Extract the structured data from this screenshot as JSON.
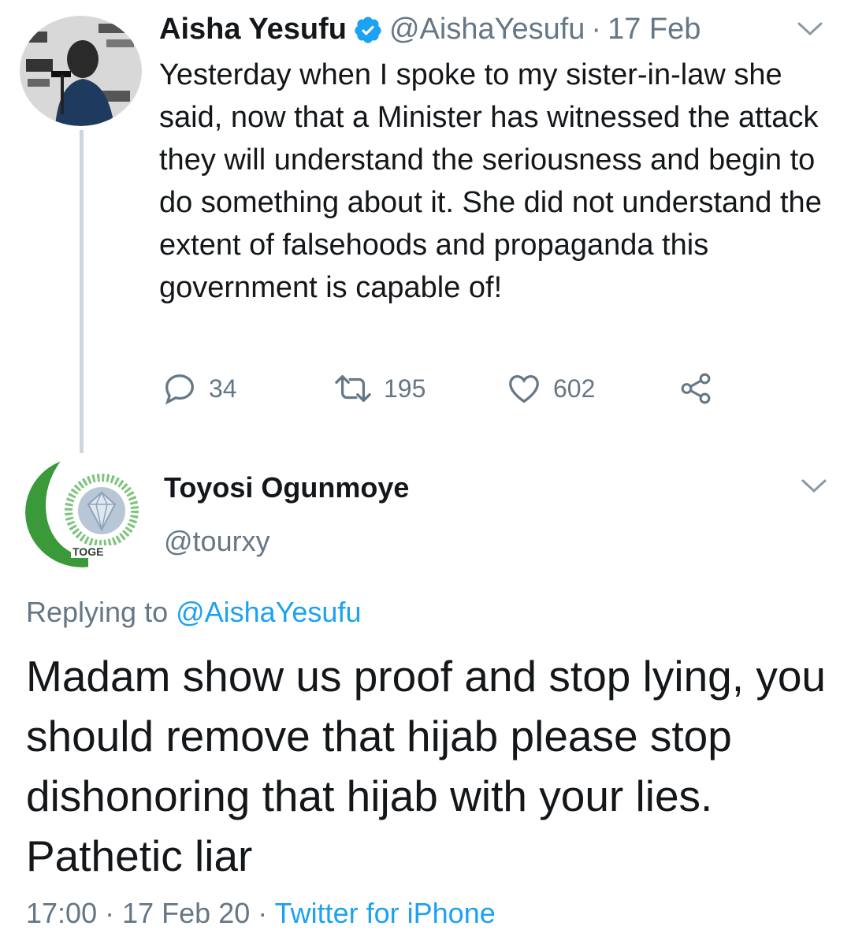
{
  "parent_tweet": {
    "author_name": "Aisha Yesufu",
    "handle": "@AishaYesufu",
    "separator": "·",
    "date": "17 Feb",
    "text": "Yesterday when I spoke to my sister-in-law she said, now that a Minister has witnessed the attack they will understand the seriousness and begin to do something about it. She did not understand the extent of falsehoods and propaganda this government is capable of!",
    "replies": "34",
    "retweets": "195",
    "likes": "602",
    "icons": [
      "reply-icon",
      "retweet-icon",
      "heart-icon",
      "share-icon",
      "verified-icon",
      "chevron-down-icon"
    ]
  },
  "reply_tweet": {
    "author_name": "Toyosi Ogunmoye",
    "handle": "@tourxy",
    "replying_prefix": "Replying to ",
    "replying_to": "@AishaYesufu",
    "text": "Madam show us proof and stop lying, you should remove that hijab please stop dishonoring that hijab with your lies. Pathetic liar",
    "time": "17:00",
    "date": "17 Feb 20",
    "separator": "·",
    "source": "Twitter for iPhone",
    "avatar_text": "TOGE"
  },
  "colors": {
    "text": "#14171a",
    "secondary": "#657786",
    "link": "#1da1f2",
    "thread_line": "#ccd6dd",
    "avatar_green": "#3a9a3a"
  }
}
